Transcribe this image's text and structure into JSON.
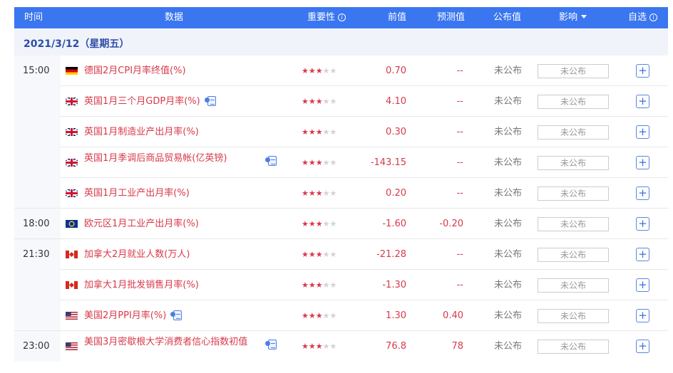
{
  "header": {
    "time": "时间",
    "data": "数据",
    "importance": "重要性",
    "previous": "前值",
    "forecast": "预测值",
    "actual": "公布值",
    "impact": "影响",
    "watchlist": "自选"
  },
  "date_label": "2021/3/12（星期五）",
  "icons": {
    "info": "info-icon",
    "caret": "caret-down-icon",
    "report": "report-icon",
    "add": "plus-icon"
  },
  "colors": {
    "header_bg": "#3a76f0",
    "accent_red": "#d8394a",
    "date_text": "#2d4ca8"
  },
  "rows": [
    {
      "time": "15:00",
      "flag": "de",
      "name": "德国2月CPI月率终值(%)",
      "report": false,
      "stars": 3,
      "prev": "0.70",
      "forecast": "--",
      "actual": "未公布",
      "impact": "未公布"
    },
    {
      "time": "",
      "flag": "uk",
      "name": "英国1月三个月GDP月率(%)",
      "report": true,
      "stars": 3,
      "prev": "4.10",
      "forecast": "--",
      "actual": "未公布",
      "impact": "未公布"
    },
    {
      "time": "",
      "flag": "uk",
      "name": "英国1月制造业产出月率(%)",
      "report": false,
      "stars": 3,
      "prev": "0.30",
      "forecast": "--",
      "actual": "未公布",
      "impact": "未公布"
    },
    {
      "time": "",
      "flag": "uk",
      "name": "英国1月季调后商品贸易帐(亿英镑)",
      "report": true,
      "stars": 3,
      "prev": "-143.15",
      "forecast": "--",
      "actual": "未公布",
      "impact": "未公布"
    },
    {
      "time": "",
      "flag": "uk",
      "name": "英国1月工业产出月率(%)",
      "report": false,
      "stars": 3,
      "prev": "0.20",
      "forecast": "--",
      "actual": "未公布",
      "impact": "未公布"
    },
    {
      "time": "18:00",
      "flag": "eu",
      "name": "欧元区1月工业产出月率(%)",
      "report": false,
      "stars": 3,
      "prev": "-1.60",
      "forecast": "-0.20",
      "actual": "未公布",
      "impact": "未公布"
    },
    {
      "time": "21:30",
      "flag": "ca",
      "name": "加拿大2月就业人数(万人)",
      "report": false,
      "stars": 3,
      "prev": "-21.28",
      "forecast": "--",
      "actual": "未公布",
      "impact": "未公布"
    },
    {
      "time": "",
      "flag": "ca",
      "name": "加拿大1月批发销售月率(%)",
      "report": false,
      "stars": 3,
      "prev": "-1.30",
      "forecast": "--",
      "actual": "未公布",
      "impact": "未公布"
    },
    {
      "time": "",
      "flag": "us",
      "name": "美国2月PPI月率(%)",
      "report": true,
      "stars": 3,
      "prev": "1.30",
      "forecast": "0.40",
      "actual": "未公布",
      "impact": "未公布"
    },
    {
      "time": "23:00",
      "flag": "us",
      "name": "美国3月密歇根大学消费者信心指数初值",
      "report": true,
      "stars": 3,
      "prev": "76.8",
      "forecast": "78",
      "actual": "未公布",
      "impact": "未公布"
    }
  ]
}
